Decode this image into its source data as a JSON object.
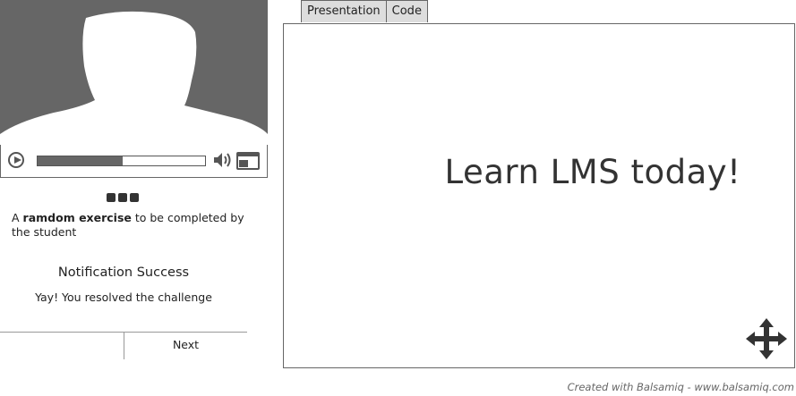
{
  "video": {
    "progress_fraction": 0.51,
    "icons": [
      "play-icon",
      "volume-icon",
      "fullscreen-icon",
      "person-silhouette"
    ]
  },
  "pager": {
    "icons": [
      "dot",
      "dot",
      "dot"
    ]
  },
  "exercise": {
    "prefix": "A ",
    "bold": "ramdom exercise",
    "suffix": " to be completed by the student"
  },
  "notification": {
    "title": "Notification Success",
    "message": "Yay! You resolved the challenge"
  },
  "actions": {
    "next_label": "Next"
  },
  "tabs": [
    {
      "label": "Presentation"
    },
    {
      "label": "Code"
    }
  ],
  "presentation": {
    "headline": "Learn LMS today!"
  },
  "footer": {
    "credit": "Created with Balsamiq - www.balsamiq.com"
  },
  "colors": {
    "screen": "#666666",
    "text": "#333333",
    "tab": "#dddddd"
  }
}
